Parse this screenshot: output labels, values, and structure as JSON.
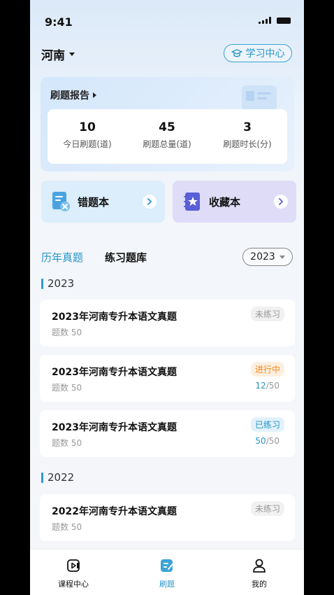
{
  "status": {
    "time": "9:41"
  },
  "header": {
    "region": "河南",
    "learn_center": "学习中心"
  },
  "report": {
    "title": "刷题报告",
    "stats": [
      {
        "value": "10",
        "label": "今日刷题(道)"
      },
      {
        "value": "45",
        "label": "刷题总量(道)"
      },
      {
        "value": "3",
        "label": "刷题时长(分)"
      }
    ]
  },
  "books": {
    "wrong": "错题本",
    "favorite": "收藏本"
  },
  "tabs": {
    "active": "历年真题",
    "other": "练习题库"
  },
  "year_select": "2023",
  "groups": [
    {
      "year": "2023",
      "items": [
        {
          "title": "2023年河南专升本语文真题",
          "count": "题数 50",
          "status": "未练习"
        },
        {
          "title": "2023年河南专升本语文真题",
          "count": "题数 50",
          "status": "进行中",
          "done": "12",
          "total": "/50"
        },
        {
          "title": "2023年河南专升本语文真题",
          "count": "题数 50",
          "status": "已练习",
          "done": "50",
          "total": "/50"
        }
      ]
    },
    {
      "year": "2022",
      "items": [
        {
          "title": "2022年河南专升本语文真题",
          "count": "题数 50",
          "status": "未练习"
        }
      ]
    }
  ],
  "nav": {
    "courses": "课程中心",
    "practice": "刷题",
    "mine": "我的"
  },
  "colors": {
    "accent": "#2795c7",
    "in_progress": "#f08a24"
  }
}
